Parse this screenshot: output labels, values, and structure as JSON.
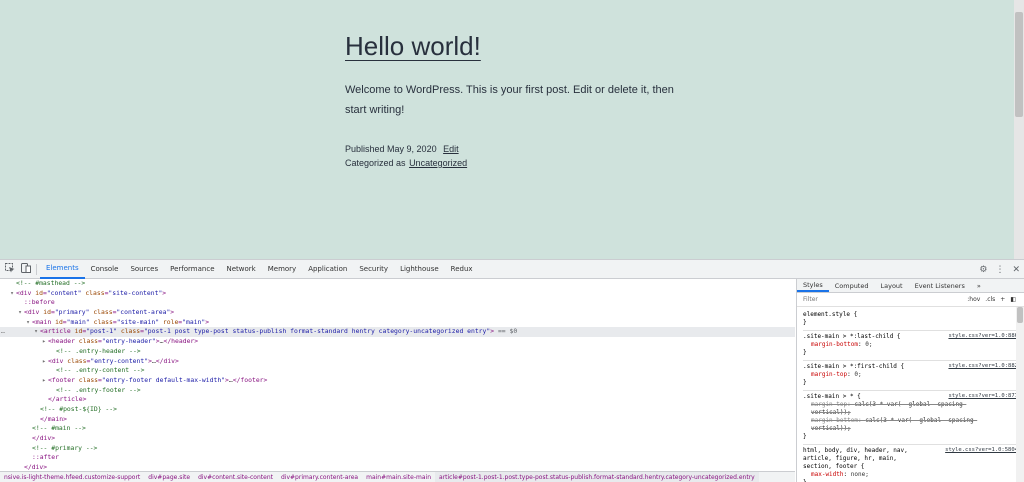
{
  "post": {
    "title": "Hello world!",
    "body": "Welcome to WordPress. This is your first post. Edit or delete it, then start writing!",
    "published_prefix": "Published",
    "published_date": "May 9, 2020",
    "edit_link": "Edit",
    "categorized_prefix": "Categorized as",
    "category_link": "Uncategorized"
  },
  "devtools": {
    "tabs": [
      "Elements",
      "Console",
      "Sources",
      "Performance",
      "Network",
      "Memory",
      "Application",
      "Security",
      "Lighthouse",
      "Redux"
    ],
    "active_tab": "Elements",
    "tab_icons": {
      "inspect": "inspect-element-icon",
      "device": "device-toolbar-icon",
      "settings": "gear-icon",
      "more": "kebab-menu-icon",
      "close": "close-icon"
    },
    "dom": [
      {
        "indent": 2,
        "tri": "",
        "html": "<span class='cmt'>&lt;!-- #masthead --&gt;</span>"
      },
      {
        "indent": 2,
        "tri": "▼",
        "html": "<span class='tag'>&lt;div </span><span class='attr'>id</span>=<span class='val'>\"content\"</span> <span class='attr'>class</span>=<span class='val'>\"site-content\"</span><span class='tag'>&gt;</span>"
      },
      {
        "indent": 4,
        "tri": "",
        "html": "<span class='pseudo'>::before</span>"
      },
      {
        "indent": 4,
        "tri": "▼",
        "html": "<span class='tag'>&lt;div </span><span class='attr'>id</span>=<span class='val'>\"primary\"</span> <span class='attr'>class</span>=<span class='val'>\"content-area\"</span><span class='tag'>&gt;</span>"
      },
      {
        "indent": 6,
        "tri": "▼",
        "html": "<span class='tag'>&lt;main </span><span class='attr'>id</span>=<span class='val'>\"main\"</span> <span class='attr'>class</span>=<span class='val'>\"site-main\"</span> <span class='attr'>role</span>=<span class='val'>\"main\"</span><span class='tag'>&gt;</span>"
      },
      {
        "indent": 8,
        "tri": "▼",
        "selected": true,
        "html": "<span class='tag'>&lt;article </span><span class='attr'>id</span>=<span class='val'>\"post-1\"</span> <span class='attr'>class</span>=<span class='val'>\"post-1 post type-post status-publish format-standard hentry category-uncategorized entry\"</span><span class='tag'>&gt;</span> <span class='sel-marker'>== $0</span>"
      },
      {
        "indent": 10,
        "tri": "▶",
        "html": "<span class='tag'>&lt;header </span><span class='attr'>class</span>=<span class='val'>\"entry-header\"</span><span class='tag'>&gt;</span><span class='txt'>…</span><span class='tag'>&lt;/header&gt;</span>"
      },
      {
        "indent": 12,
        "tri": "",
        "html": "<span class='cmt'>&lt;!-- .entry-header --&gt;</span>"
      },
      {
        "indent": 10,
        "tri": "▶",
        "html": "<span class='tag'>&lt;div </span><span class='attr'>class</span>=<span class='val'>\"entry-content\"</span><span class='tag'>&gt;</span><span class='txt'>…</span><span class='tag'>&lt;/div&gt;</span>"
      },
      {
        "indent": 12,
        "tri": "",
        "html": "<span class='cmt'>&lt;!-- .entry-content --&gt;</span>"
      },
      {
        "indent": 10,
        "tri": "▶",
        "html": "<span class='tag'>&lt;footer </span><span class='attr'>class</span>=<span class='val'>\"entry-footer default-max-width\"</span><span class='tag'>&gt;</span><span class='txt'>…</span><span class='tag'>&lt;/footer&gt;</span>"
      },
      {
        "indent": 12,
        "tri": "",
        "html": "<span class='cmt'>&lt;!-- .entry-footer --&gt;</span>"
      },
      {
        "indent": 10,
        "tri": "",
        "html": "<span class='tag'>&lt;/article&gt;</span>"
      },
      {
        "indent": 8,
        "tri": "",
        "html": "<span class='cmt'>&lt;!-- #post-${ID} --&gt;</span>"
      },
      {
        "indent": 8,
        "tri": "",
        "html": "<span class='tag'>&lt;/main&gt;</span>"
      },
      {
        "indent": 6,
        "tri": "",
        "html": "<span class='cmt'>&lt;!-- #main --&gt;</span>"
      },
      {
        "indent": 6,
        "tri": "",
        "html": "<span class='tag'>&lt;/div&gt;</span>"
      },
      {
        "indent": 6,
        "tri": "",
        "html": "<span class='cmt'>&lt;!-- #primary --&gt;</span>"
      },
      {
        "indent": 6,
        "tri": "",
        "html": "<span class='pseudo'>::after</span>"
      },
      {
        "indent": 4,
        "tri": "",
        "html": "<span class='tag'>&lt;/div&gt;</span>"
      }
    ],
    "breadcrumb": [
      "nsive.is-light-theme.hfeed.customize-support",
      "div#page.site",
      "div#content.site-content",
      "div#primary.content-area",
      "main#main.site-main",
      "article#post-1.post-1.post.type-post.status-publish.format-standard.hentry.category-uncategorized.entry"
    ],
    "styles_tabs": [
      "Styles",
      "Computed",
      "Layout",
      "Event Listeners",
      "»"
    ],
    "styles_active_tab": "Styles",
    "filter_placeholder": "Filter",
    "filter_tools": [
      ":hov",
      ".cls",
      "+"
    ],
    "element_style": "element.style {",
    "rules": [
      {
        "selector": ".site-main > *:last-child {",
        "source": "style.css?ver=1.0:886",
        "props": [
          {
            "name": "margin-bottom",
            "value": "0;",
            "struck": false
          }
        ]
      },
      {
        "selector": ".site-main > *:first-child {",
        "source": "style.css?ver=1.0:882",
        "props": [
          {
            "name": "margin-top",
            "value": "0;",
            "struck": false
          }
        ]
      },
      {
        "selector": ".site-main > * {",
        "source": "style.css?ver=1.0:877",
        "props": [
          {
            "name": "margin-top",
            "value": "calc(3 * var(--global--spacing-vertical));",
            "struck": true
          },
          {
            "name": "margin-bottom",
            "value": "calc(3 * var(--global--spacing-vertical));",
            "struck": true
          }
        ]
      },
      {
        "selector": "html, body, div, header, nav, article, figure, hr, main, section, footer {",
        "source": "style.css?ver=1.0:5804",
        "props": [
          {
            "name": "max-width",
            "value": "none;",
            "struck": false
          }
        ]
      }
    ],
    "closing_brace": "}"
  }
}
